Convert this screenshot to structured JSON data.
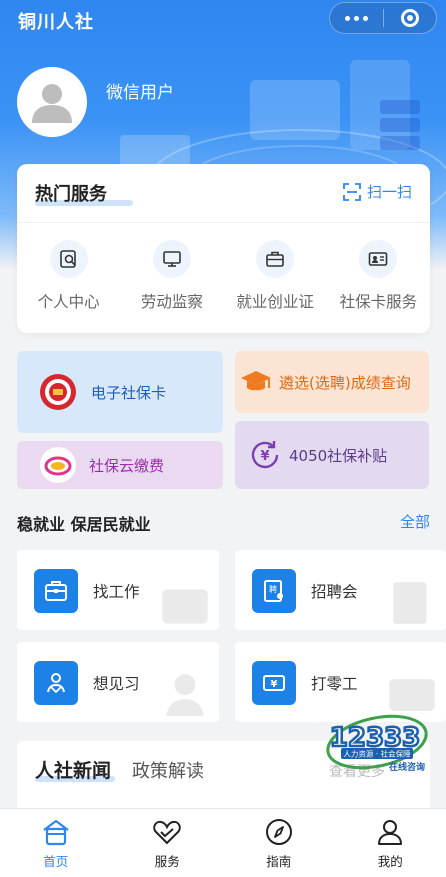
{
  "header": {
    "title": "铜川人社"
  },
  "user": {
    "name": "微信用户"
  },
  "hot_services": {
    "title": "热门服务",
    "scan_label": "扫一扫",
    "items": [
      {
        "label": "个人中心",
        "icon": "search-doc-icon"
      },
      {
        "label": "劳动监察",
        "icon": "monitor-icon"
      },
      {
        "label": "就业创业证",
        "icon": "briefcase-icon"
      },
      {
        "label": "社保卡服务",
        "icon": "id-card-icon"
      }
    ]
  },
  "tiles": {
    "ecard": "电子社保卡",
    "exam": "遴选(选聘)成绩查询",
    "cloud_pay": "社保云缴费",
    "subsidy": "4050社保补贴"
  },
  "employment": {
    "title": "稳就业 保居民就业",
    "all_label": "全部",
    "items": [
      "找工作",
      "招聘会",
      "想见习",
      "打零工"
    ]
  },
  "news": {
    "tab_active": "人社新闻",
    "tab_other": "政策解读",
    "more": "查看更多"
  },
  "badge": {
    "number": "12333",
    "line1": "人力资源 · 社会保障",
    "line2": "在线咨询"
  },
  "tabbar": [
    "首页",
    "服务",
    "指南",
    "我的"
  ],
  "colors": {
    "primary": "#2f86f0",
    "job_icon_bg": "#1d82e8"
  }
}
